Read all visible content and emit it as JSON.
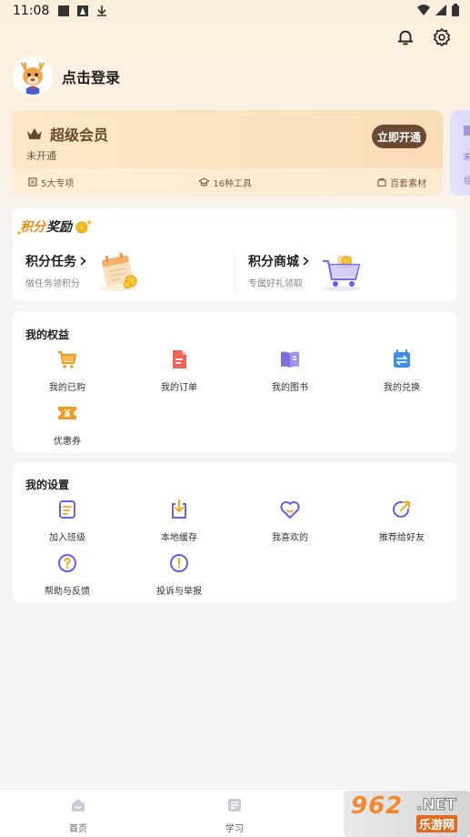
{
  "status_bar": {
    "time": "11:08"
  },
  "user": {
    "login_text": "点击登录"
  },
  "vip": {
    "title": "超级会员",
    "status": "未开通",
    "open_button": "立即开通",
    "features": [
      "5大专项",
      "16种工具",
      "百套素材"
    ],
    "peek_text": "未",
    "peek_text2": "组"
  },
  "points": {
    "title_a": "积分",
    "title_b": "奖励",
    "tasks": {
      "title": "积分任务",
      "subtitle": "做任务领积分"
    },
    "mall": {
      "title": "积分商城",
      "subtitle": "专属好礼领取"
    }
  },
  "benefits": {
    "title": "我的权益",
    "items": [
      {
        "label": "我的已购",
        "icon": "cart-icon"
      },
      {
        "label": "我的订单",
        "icon": "order-icon"
      },
      {
        "label": "我的图书",
        "icon": "book-icon"
      },
      {
        "label": "我的兑换",
        "icon": "exchange-icon"
      },
      {
        "label": "优惠券",
        "icon": "coupon-icon"
      }
    ]
  },
  "settings": {
    "title": "我的设置",
    "items": [
      {
        "label": "加入班级",
        "icon": "class-icon"
      },
      {
        "label": "本地缓存",
        "icon": "download-icon"
      },
      {
        "label": "我喜欢的",
        "icon": "heart-icon"
      },
      {
        "label": "推荐给好友",
        "icon": "share-icon"
      },
      {
        "label": "帮助与反馈",
        "icon": "help-icon"
      },
      {
        "label": "投诉与举报",
        "icon": "report-icon"
      }
    ]
  },
  "bottom_nav": [
    {
      "label": "首页"
    },
    {
      "label": "学习"
    }
  ],
  "watermark": {
    "numbers": "962",
    "net": ".NET",
    "sub": "乐游网"
  },
  "colors": {
    "accent_orange": "#f08c18",
    "accent_purple": "#6b5ce7",
    "vip_brown": "#6b4a34"
  }
}
